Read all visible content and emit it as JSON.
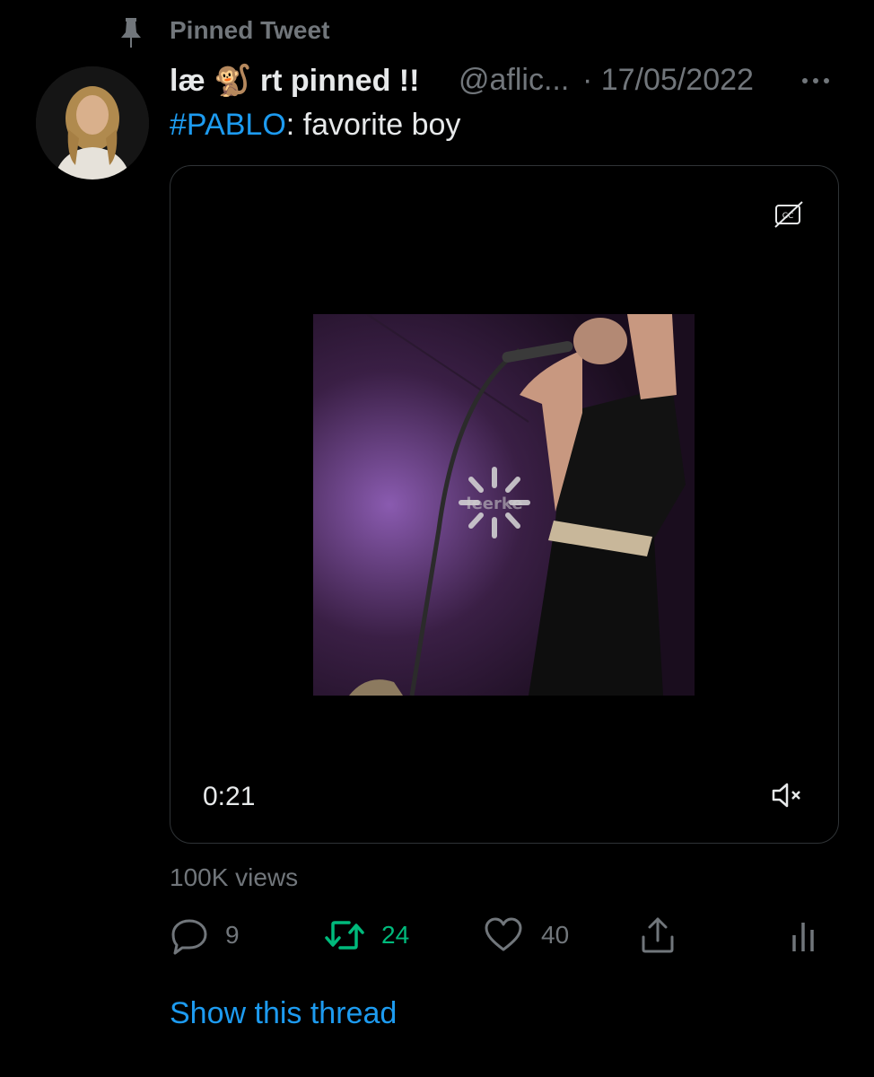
{
  "pinned": {
    "label": "Pinned Tweet",
    "icon": "pin-icon"
  },
  "tweet": {
    "author_name": "læ 🐒 rt pinned !!",
    "handle": "@aflic...",
    "date": "· 17/05/2022",
    "hashtag": "#PABLO",
    "text": ": favorite boy",
    "media": {
      "duration": "0:21",
      "watermark": "leerke",
      "icons": [
        "closed-captions-icon",
        "muted-speaker-icon",
        "loading-spinner-icon"
      ]
    },
    "views": "100K views",
    "actions": {
      "replies": "9",
      "retweets": "24",
      "likes": "40"
    },
    "show_thread": "Show this thread"
  },
  "colors": {
    "background": "#000000",
    "text": "#e7e9ea",
    "muted": "#71767b",
    "link": "#1d9bf0",
    "retweet": "#00ba7c"
  }
}
